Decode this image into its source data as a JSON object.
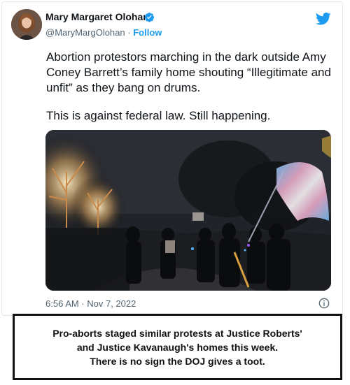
{
  "tweet": {
    "author_name": "Mary Margaret Olohan",
    "handle": "@MaryMargOlohan",
    "separator": "·",
    "follow_label": "Follow",
    "text_paragraph_1": "Abortion protestors marching in the dark outside Amy Coney Barrett’s family home shouting “Illegitimate and unfit” as they bang on drums.",
    "text_paragraph_2": "This is against federal law. Still happening.",
    "timestamp": "6:56 AM · Nov 7, 2022",
    "icons": {
      "verified": "verified-badge-icon",
      "platform": "twitter-bird-icon",
      "info": "info-icon"
    },
    "colors": {
      "accent": "#1d9bf0",
      "text": "#0f1419",
      "secondary_text": "#536471"
    }
  },
  "caption": {
    "line_1": "Pro-aborts staged similar protests at Justice Roberts'",
    "line_2": "and Justice Kavanaugh's homes this week.",
    "line_3": "There is no sign the DOJ gives a toot."
  }
}
